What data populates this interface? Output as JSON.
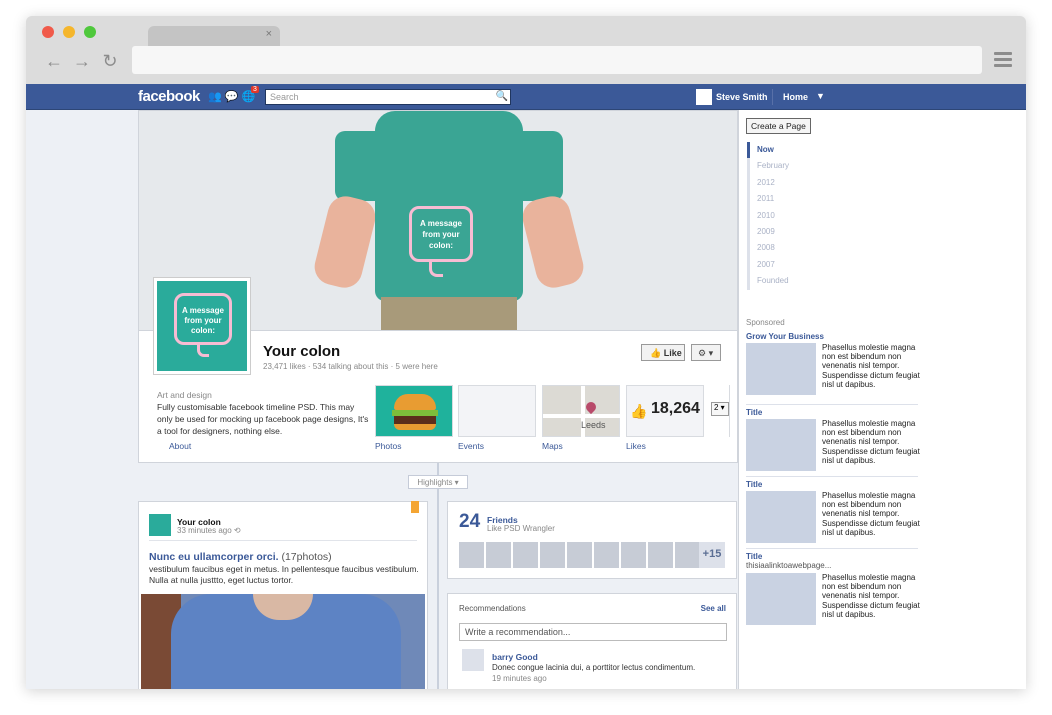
{
  "browser": {
    "tab_close": "×",
    "back": "←",
    "forward": "→",
    "reload": "↻"
  },
  "fb": {
    "logo": "facebook",
    "jewels": "👥 💬 🌐",
    "notification_count": "3",
    "search_placeholder": "Search",
    "search_icon": "🔍",
    "user_name": "Steve Smith",
    "home": "Home",
    "caret": "▼"
  },
  "cover": {
    "message": "A message from your colon:"
  },
  "page": {
    "profile_message": "A message from your colon:",
    "name": "Your colon",
    "stats": "23,471 likes · 534 talking about this · 5 were here",
    "like_label": "👍 Like",
    "gear_label": "⚙ ▾",
    "category": "Art and design",
    "about_text": "Fully customisable facebook timeline PSD. This may only be used for mocking up facebook page designs, It's a tool for designers, nothing else.",
    "likes_count": "18,264",
    "likes_dropdown": "2 ▾",
    "map_label": "Leeds",
    "tabs": {
      "about": "About",
      "photos": "Photos",
      "events": "Events",
      "maps": "Maps",
      "likes": "Likes"
    }
  },
  "timeline": {
    "highlights": "Highlights ▾"
  },
  "post": {
    "author": "Your colon",
    "time": "33 minutes ago ⟲",
    "title": "Nunc eu ullamcorper orci.",
    "photo_count": "(17photos)",
    "body": "vestibulum faucibus eget in metus. In pellentesque faucibus vestibulum. Nulla at nulla justtto, eget luctus tortor."
  },
  "friends": {
    "count": "24",
    "label": "Friends",
    "sub": "Like PSD Wrangler",
    "more": "+15"
  },
  "recommendations": {
    "title": "Recommendations",
    "see_all": "See all",
    "placeholder": "Write a recommendation...",
    "item": {
      "name": "barry Good",
      "text": "Donec congue lacinia dui, a porttitor lectus condimentum.",
      "time": "19 minutes ago"
    }
  },
  "sidebar": {
    "create_page": "Create a Page",
    "years": [
      "Now",
      "February",
      "2012",
      "2011",
      "2010",
      "2009",
      "2008",
      "2007",
      "Founded"
    ],
    "sponsored": "Sponsored",
    "ads": [
      {
        "title": "Grow Your Business",
        "sub": "",
        "text": "Phasellus molestie magna non est bibendum non venenatis nisl tempor. Suspendisse dictum feugiat nisl ut dapibus."
      },
      {
        "title": "Title",
        "sub": "",
        "text": "Phasellus molestie magna non est bibendum non venenatis nisl tempor. Suspendisse dictum feugiat nisl ut dapibus."
      },
      {
        "title": "Title",
        "sub": "",
        "text": "Phasellus molestie magna non est bibendum non venenatis nisl tempor. Suspendisse dictum feugiat nisl ut dapibus."
      },
      {
        "title": "Title",
        "sub": "thisiaalinktoawebpage...",
        "text": "Phasellus molestie magna non est bibendum non venenatis nisl tempor. Suspendisse dictum feugiat nisl ut dapibus."
      }
    ]
  },
  "colors": {
    "fb_blue": "#3b5998",
    "teal": "#2aab9b",
    "pink": "#f7bcd3"
  }
}
